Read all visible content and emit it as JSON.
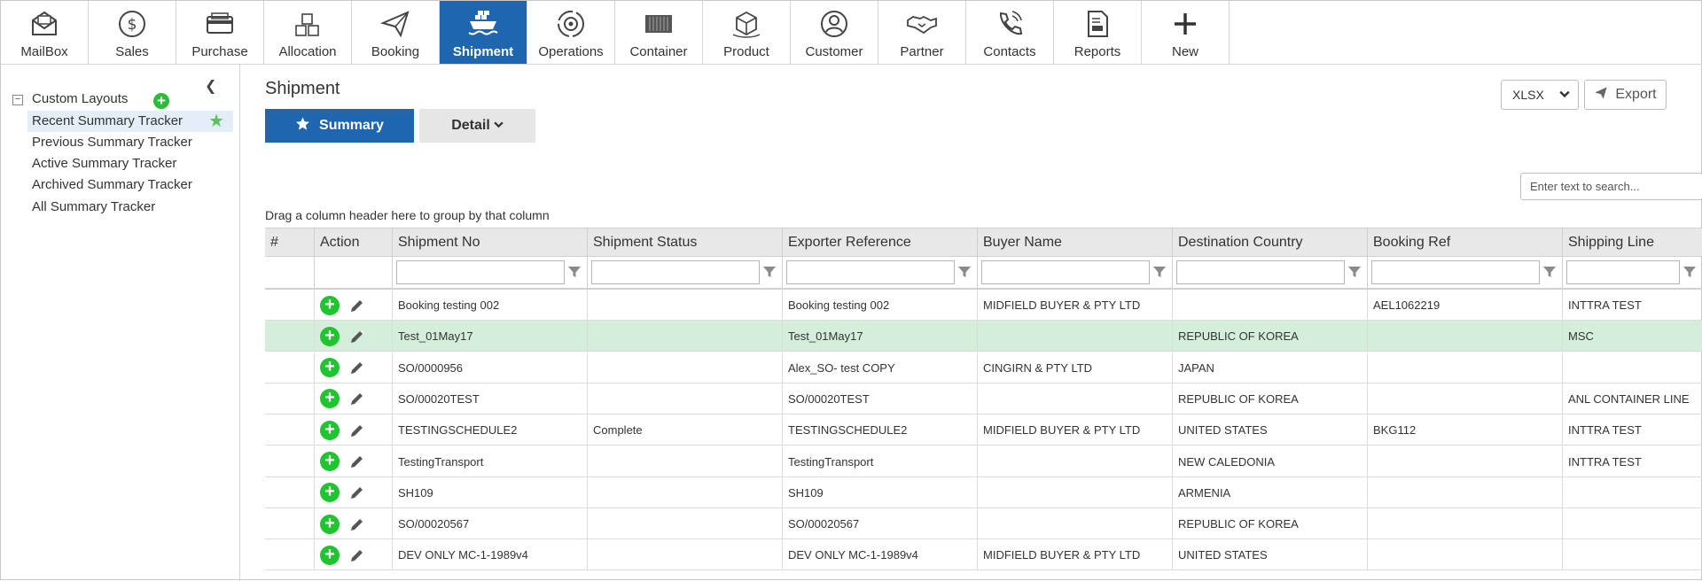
{
  "nav": [
    {
      "label": "MailBox",
      "icon": "mailbox-icon"
    },
    {
      "label": "Sales",
      "icon": "dollar-icon"
    },
    {
      "label": "Purchase",
      "icon": "credit-card-icon"
    },
    {
      "label": "Allocation",
      "icon": "boxes-icon"
    },
    {
      "label": "Booking",
      "icon": "paper-plane-icon"
    },
    {
      "label": "Shipment",
      "icon": "ship-icon",
      "active": true
    },
    {
      "label": "Operations",
      "icon": "gear-cycle-icon"
    },
    {
      "label": "Container",
      "icon": "container-icon"
    },
    {
      "label": "Product",
      "icon": "package-icon"
    },
    {
      "label": "Customer",
      "icon": "user-icon"
    },
    {
      "label": "Partner",
      "icon": "handshake-icon"
    },
    {
      "label": "Contacts",
      "icon": "phone-icon"
    },
    {
      "label": "Reports",
      "icon": "report-icon"
    },
    {
      "label": "New",
      "icon": "plus-icon"
    }
  ],
  "sidebar": {
    "root_label": "Custom Layouts",
    "toggle": "−",
    "items": [
      {
        "label": "Recent Summary Tracker",
        "selected": true
      },
      {
        "label": "Previous Summary Tracker"
      },
      {
        "label": "Active Summary Tracker"
      },
      {
        "label": "Archived Summary Tracker"
      },
      {
        "label": "All Summary Tracker"
      }
    ]
  },
  "main": {
    "title": "Shipment",
    "summary_label": "Summary",
    "detail_label": "Detail",
    "format_value": "XLSX",
    "export_label": "Export",
    "search_placeholder": "Enter text to search...",
    "group_hint": "Drag a column header here to group by that column"
  },
  "grid": {
    "columns": [
      "#",
      "Action",
      "Shipment No",
      "Shipment Status",
      "Exporter Reference",
      "Buyer Name",
      "Destination Country",
      "Booking Ref",
      "Shipping Line"
    ],
    "filterable": [
      false,
      false,
      true,
      true,
      true,
      true,
      true,
      true,
      true
    ],
    "rows": [
      {
        "shipment_no": "Booking testing 002",
        "status": "",
        "exporter_ref": "Booking testing 002",
        "buyer": "MIDFIELD BUYER & PTY LTD",
        "country": "",
        "booking_ref": "AEL1062219",
        "line": "INTTRA TEST"
      },
      {
        "shipment_no": "Test_01May17",
        "status": "",
        "exporter_ref": "Test_01May17",
        "buyer": "",
        "country": "REPUBLIC OF KOREA",
        "booking_ref": "",
        "line": "MSC",
        "highlighted": true
      },
      {
        "shipment_no": "SO/0000956",
        "status": "",
        "exporter_ref": "Alex_SO- test COPY",
        "buyer": "CINGIRN & PTY LTD",
        "country": "JAPAN",
        "booking_ref": "",
        "line": ""
      },
      {
        "shipment_no": "SO/00020TEST",
        "status": "",
        "exporter_ref": "SO/00020TEST",
        "buyer": "",
        "country": "REPUBLIC OF KOREA",
        "booking_ref": "",
        "line": "ANL CONTAINER LINE"
      },
      {
        "shipment_no": "TESTINGSCHEDULE2",
        "status": "Complete",
        "exporter_ref": "TESTINGSCHEDULE2",
        "buyer": "MIDFIELD BUYER & PTY LTD",
        "country": "UNITED STATES",
        "booking_ref": "BKG112",
        "line": "INTTRA TEST"
      },
      {
        "shipment_no": "TestingTransport",
        "status": "",
        "exporter_ref": "TestingTransport",
        "buyer": "",
        "country": "NEW CALEDONIA",
        "booking_ref": "",
        "line": "INTTRA TEST"
      },
      {
        "shipment_no": "SH109",
        "status": "",
        "exporter_ref": "SH109",
        "buyer": "",
        "country": "ARMENIA",
        "booking_ref": "",
        "line": ""
      },
      {
        "shipment_no": "SO/00020567",
        "status": "",
        "exporter_ref": "SO/00020567",
        "buyer": "",
        "country": "REPUBLIC OF KOREA",
        "booking_ref": "",
        "line": ""
      },
      {
        "shipment_no": "DEV ONLY MC-1-1989v4",
        "status": "",
        "exporter_ref": "DEV ONLY MC-1-1989v4",
        "buyer": "MIDFIELD BUYER & PTY LTD",
        "country": "UNITED STATES",
        "booking_ref": "",
        "line": ""
      }
    ]
  },
  "colors": {
    "accent": "#1f66b1",
    "add_green": "#1fc42f",
    "highlight_row": "#d5eedb",
    "favorite_star": "#5cc05c"
  }
}
